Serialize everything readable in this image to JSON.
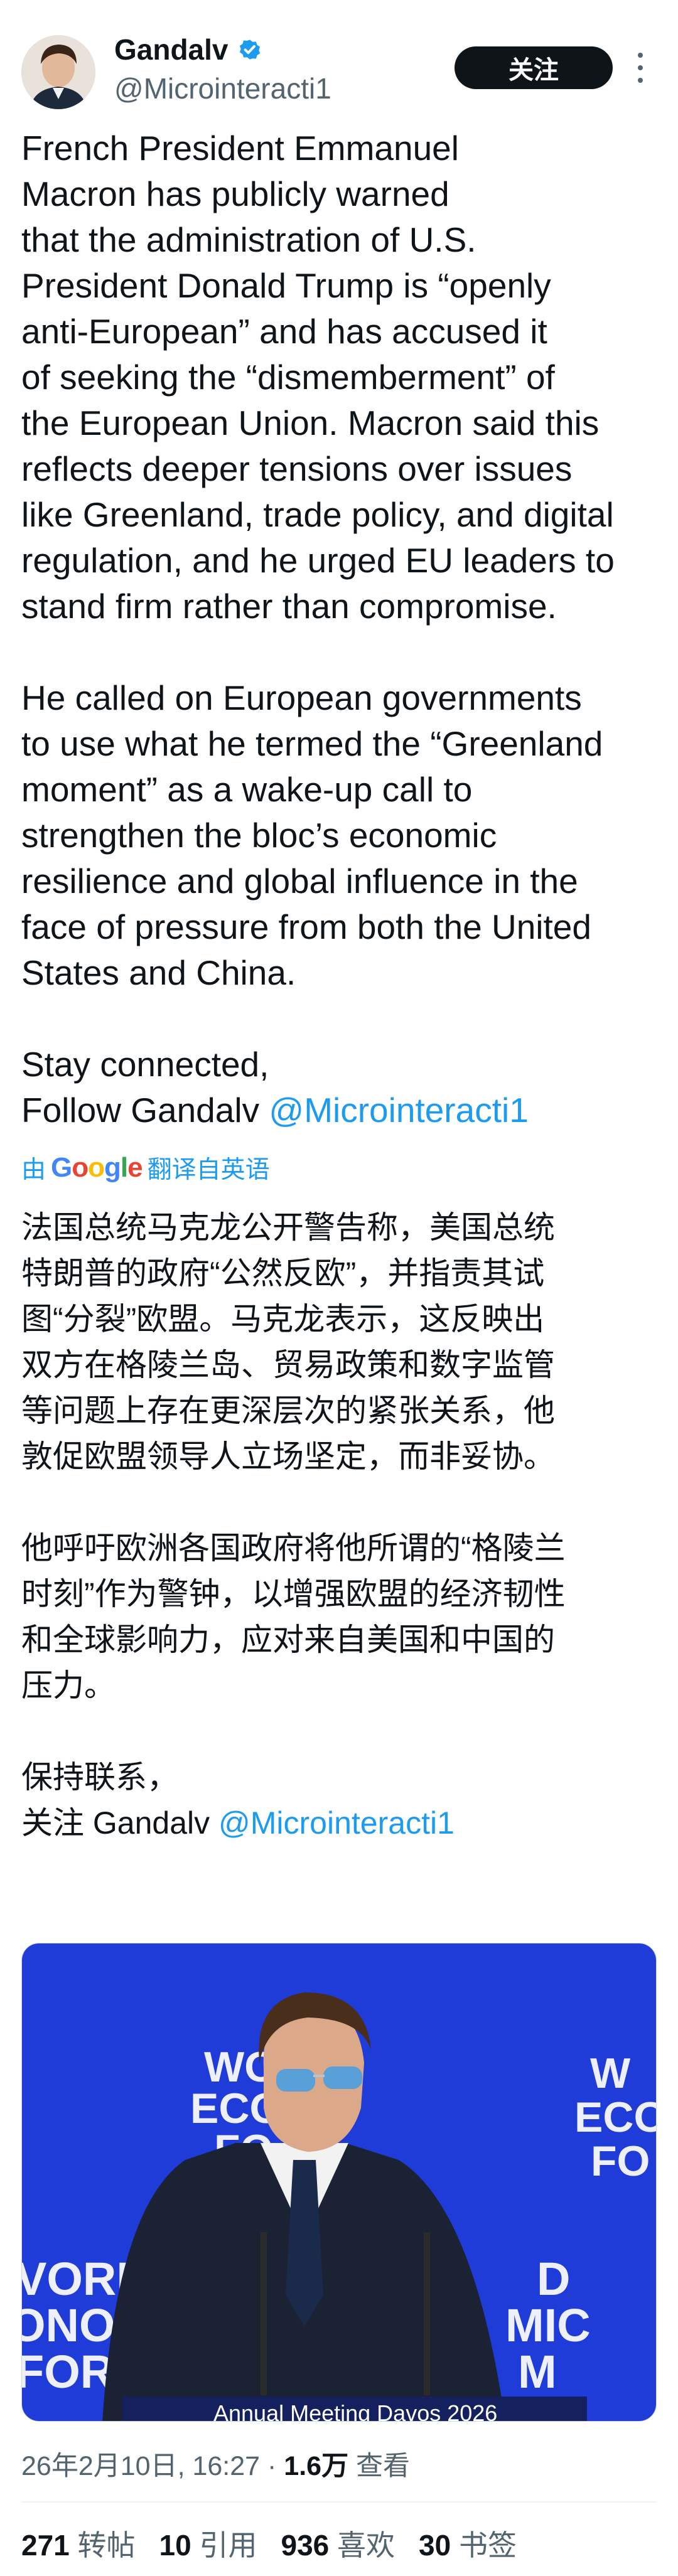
{
  "author": {
    "name": "Gandalv",
    "handle": "@Microinteracti1",
    "follow_label": "关注",
    "verified_color": "#1d9bf0"
  },
  "tweet": {
    "paragraphs": [
      "French President Emmanuel\nMacron has publicly warned\nthat the administration of U.S.\nPresident Donald Trump is “openly\nanti-European” and has accused it\nof seeking the “dismemberment” of\nthe European Union. Macron said this\nreflects deeper tensions over issues\nlike Greenland, trade policy, and digital\nregulation, and he urged EU leaders to\nstand firm rather than compromise.",
      "He called on European governments\nto use what he termed the “Greenland\nmoment” as a wake-up call to\nstrengthen the bloc’s economic\nresilience and global influence in the\nface of pressure from both the United\nStates and China.",
      "Stay connected,"
    ],
    "follow_prefix": "Follow Gandalv ",
    "mention": "@Microinteracti1"
  },
  "translation": {
    "by": "由",
    "google": "Google",
    "label": "翻译自英语",
    "lines_p1": [
      "法国总统马克龙公开警告称，美国总统",
      "特朗普的政府“公然反欧”，并指责其试",
      "图“分裂”欧盟。马克龙表示，这反映出",
      "双方在格陵兰岛、贸易政策和数字监管",
      "等问题上存在更深层次的紧张关系，他",
      "敦促欧盟领导人立场坚定，而非妥协。"
    ],
    "lines_p2": [
      "他呼吁欧洲各国政府将他所谓的“格陵兰",
      "时刻”作为警钟，以增强欧盟的经济韧性",
      "和全球影响力，应对来自美国和中国的",
      "压力。"
    ],
    "stay": "保持联系，",
    "follow_prefix": "关注 Gandalv ",
    "mention": "@Microinteracti1"
  },
  "media": {
    "banner_text": "Annual Meeting Davos 2026",
    "logo_left_small": "WORLD\nECONOMIC",
    "brand_color": "#1f3bd8"
  },
  "meta": {
    "timestamp": "26年2月10日, 16:27 · ",
    "views_count": "1.6万",
    "views_label": " 查看"
  },
  "stats": [
    {
      "count": "271",
      "label": "转帖"
    },
    {
      "count": "10",
      "label": "引用"
    },
    {
      "count": "936",
      "label": "喜欢"
    },
    {
      "count": "30",
      "label": "书签"
    }
  ]
}
